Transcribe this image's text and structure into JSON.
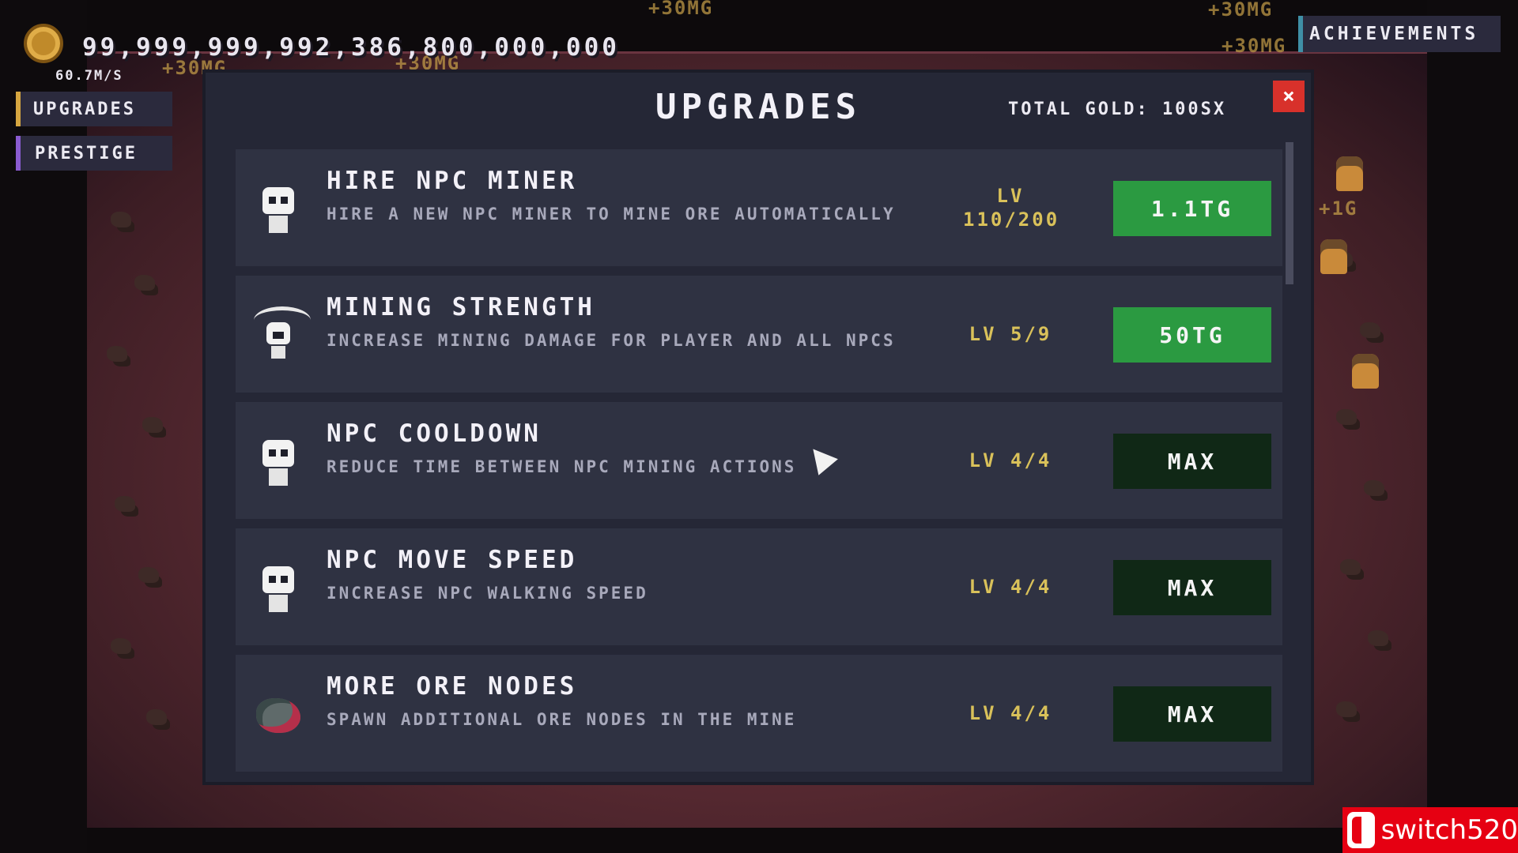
{
  "hud": {
    "gold_amount": "99,999,999,992,386,800,000,000",
    "gold_rate": "60.7M/S"
  },
  "nav": {
    "upgrades_label": "UPGRADES",
    "prestige_label": "PRESTIGE",
    "achievements_label": "ACHIEVEMENTS"
  },
  "floaters": [
    "+30MG",
    "+30MG",
    "+30MG",
    "+30MG",
    "+30MG",
    "+1G"
  ],
  "modal": {
    "title": "UPGRADES",
    "total_gold": "TOTAL GOLD: 100SX",
    "close_label": "×",
    "items": [
      {
        "title": "HIRE NPC MINER",
        "description": "HIRE A NEW NPC MINER TO MINE ORE AUTOMATICALLY",
        "level": "LV 110/200",
        "button": "1.1TG",
        "icon": "skull-npc-icon"
      },
      {
        "title": "MINING STRENGTH",
        "description": "INCREASE MINING DAMAGE FOR PLAYER AND ALL NPCS",
        "level": "LV 5/9",
        "button": "50TG",
        "icon": "pickaxe-skull-icon"
      },
      {
        "title": "NPC COOLDOWN",
        "description": "REDUCE TIME BETWEEN NPC MINING ACTIONS",
        "level": "LV 4/4",
        "button": "MAX",
        "icon": "skull-npc-icon"
      },
      {
        "title": "NPC MOVE SPEED",
        "description": "INCREASE NPC WALKING SPEED",
        "level": "LV 4/4",
        "button": "MAX",
        "icon": "skull-npc-icon"
      },
      {
        "title": "MORE ORE NODES",
        "description": "SPAWN ADDITIONAL ORE NODES IN THE MINE",
        "level": "LV 4/4",
        "button": "MAX",
        "icon": "ore-node-icon"
      }
    ]
  },
  "watermark": {
    "text": "switch520"
  },
  "colors": {
    "buy_button": "#2b9a41",
    "max_button": "#102816",
    "close_button": "#d8312b",
    "level_text": "#d9c15a",
    "modal_bg": "#252736",
    "row_bg": "#2f3242"
  }
}
